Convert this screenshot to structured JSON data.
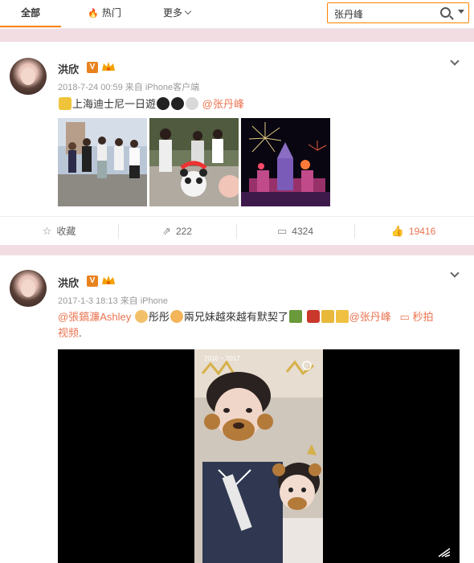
{
  "tabs": {
    "all": "全部",
    "hot": "热门",
    "more": "更多"
  },
  "search": {
    "value": "张丹峰"
  },
  "posts": [
    {
      "author": "洪欣",
      "time": "2018-7-24 00:59",
      "source": "来自 iPhone客户端",
      "text": "上海迪士尼一日遊",
      "mention": "@张丹峰",
      "actions": {
        "favorite": "收藏",
        "repost": "222",
        "comment": "4324",
        "like": "19416"
      }
    },
    {
      "author": "洪欣",
      "time": "2017-1-3 18:13",
      "source": "来自 iPhone",
      "mention1": "@張鎬濂Ashley",
      "text_a": "彤彤",
      "text_b": "兩兄妹越來越有默契了",
      "mention2": "@张丹峰",
      "video_label": "秒拍",
      "text_c": "视频",
      "text_end": "."
    }
  ],
  "colors": {
    "accent": "#ff8200",
    "link": "#eb7350",
    "page_bg": "#f2dde3"
  }
}
